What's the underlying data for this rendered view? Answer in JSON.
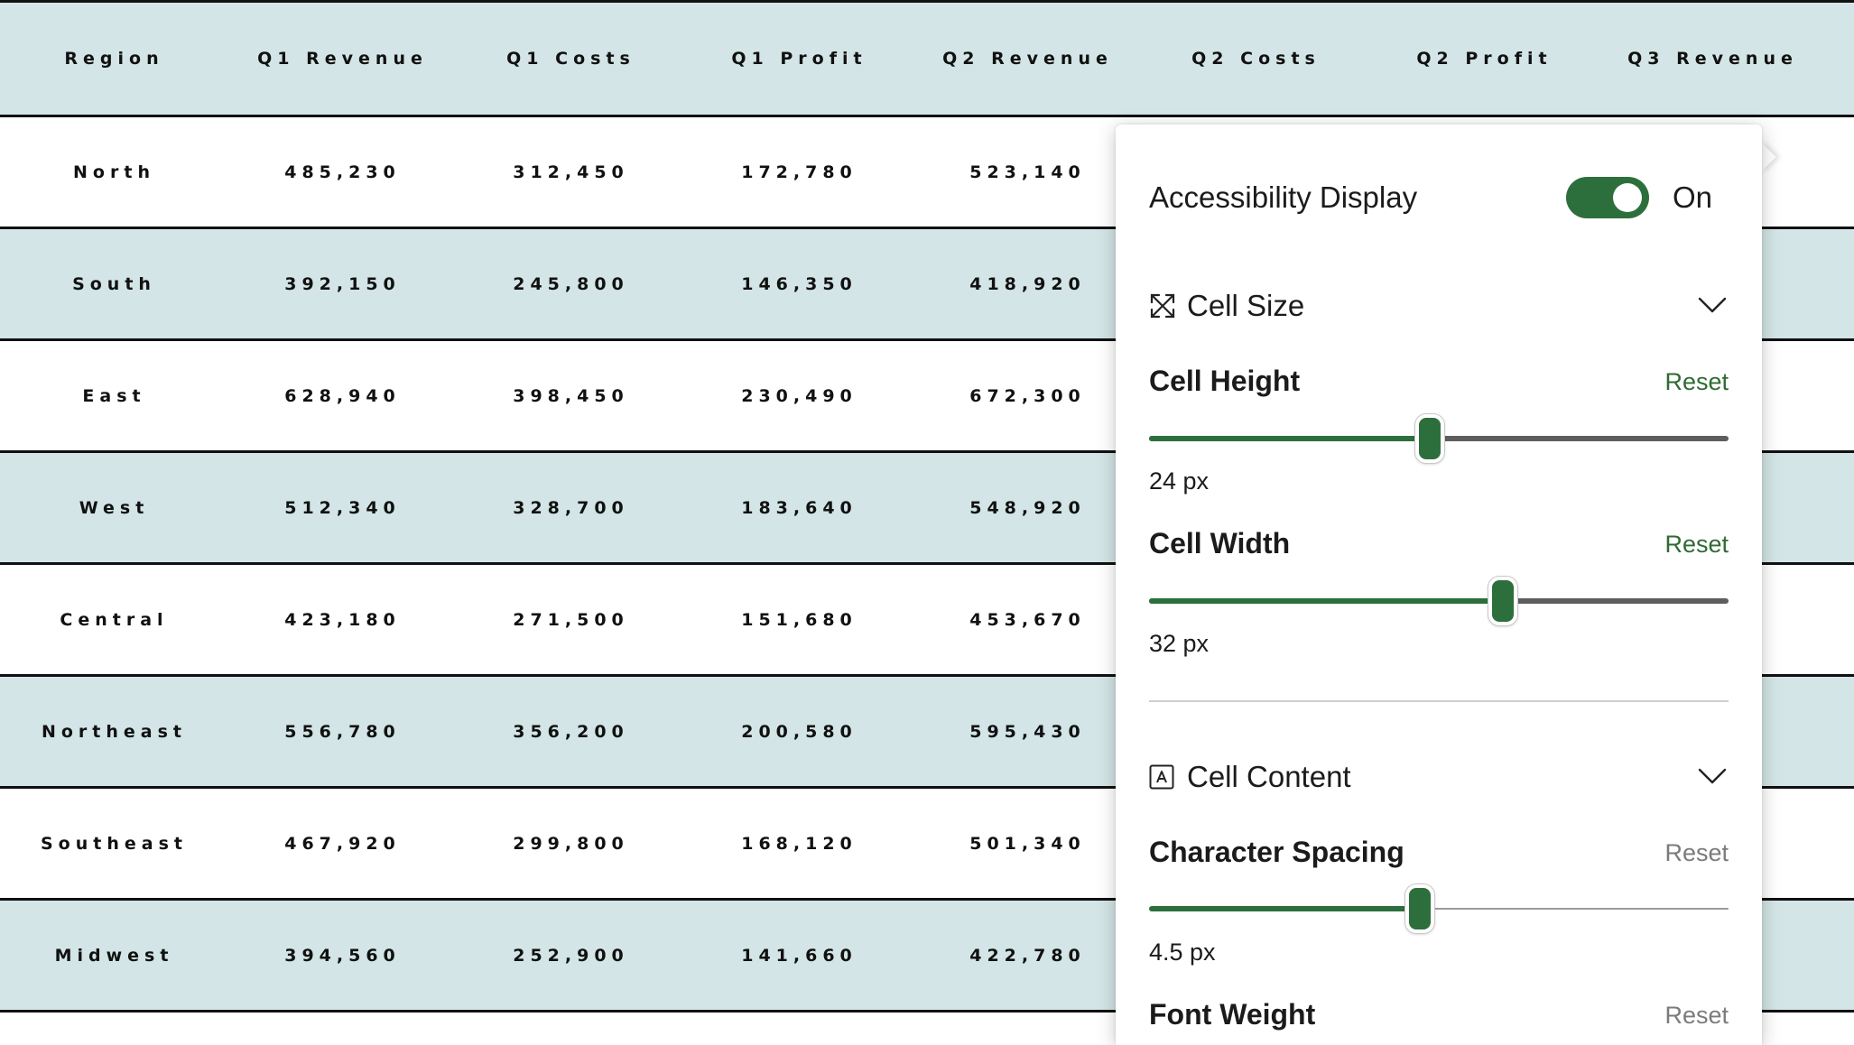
{
  "table": {
    "columns": [
      "Region",
      "Q1 Revenue",
      "Q1 Costs",
      "Q1 Profit",
      "Q2 Revenue",
      "Q2 Costs",
      "Q2 Profit",
      "Q3 Revenue"
    ],
    "rows": [
      [
        "North",
        "485,230",
        "312,450",
        "172,780",
        "523,140"
      ],
      [
        "South",
        "392,150",
        "245,800",
        "146,350",
        "418,920"
      ],
      [
        "East",
        "628,940",
        "398,450",
        "230,490",
        "672,300"
      ],
      [
        "West",
        "512,340",
        "328,700",
        "183,640",
        "548,920"
      ],
      [
        "Central",
        "423,180",
        "271,500",
        "151,680",
        "453,670"
      ],
      [
        "Northeast",
        "556,780",
        "356,200",
        "200,580",
        "595,430"
      ],
      [
        "Southeast",
        "467,920",
        "299,800",
        "168,120",
        "501,340"
      ],
      [
        "Midwest",
        "394,560",
        "252,900",
        "141,660",
        "422,780"
      ]
    ]
  },
  "panel": {
    "title": "Accessibility Display",
    "toggle_state": "On",
    "toggle_on": true,
    "cell_size": {
      "section_label": "Cell Size",
      "height": {
        "label": "Cell Height",
        "reset": "Reset",
        "value": "24 px",
        "fraction": 0.485
      },
      "width": {
        "label": "Cell Width",
        "reset": "Reset",
        "value": "32 px",
        "fraction": 0.61
      }
    },
    "cell_content": {
      "section_label": "Cell Content",
      "spacing": {
        "label": "Character Spacing",
        "reset": "Reset",
        "value": "4.5 px",
        "fraction": 0.468
      },
      "weight": {
        "label": "Font Weight",
        "reset": "Reset"
      }
    }
  },
  "colors": {
    "accent": "#2d6f3c",
    "header_bg": "#d3e5e6",
    "reset_active": "#2f6b33",
    "reset_muted": "#7b7b7b"
  }
}
